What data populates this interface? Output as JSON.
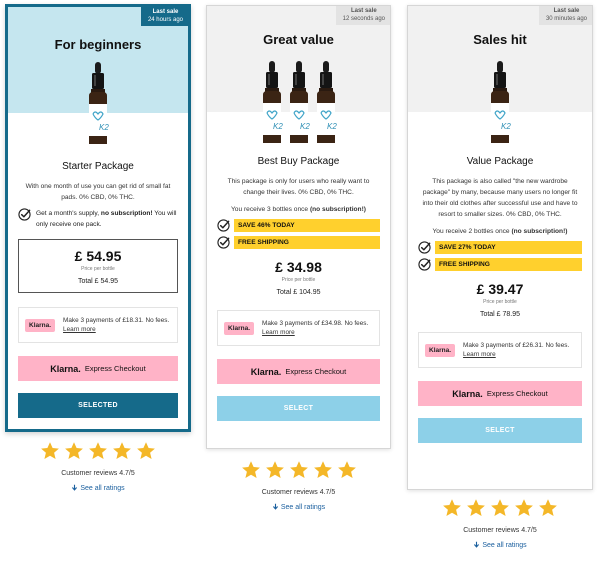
{
  "colors": {
    "selected_blue": "#156a8a",
    "light_blue": "#8dd0e8",
    "klarna_pink": "#ffb3c7",
    "promo_yellow": "#ffd02d",
    "star_gold": "#f4b728"
  },
  "cards": [
    {
      "last_sale_label": "Last sale",
      "last_sale_time": "24 hours ago",
      "heading": "For beginners",
      "package_name": "Starter Package",
      "description": "With one month of use you can get rid of small fat pads. 0% CBD, 0% THC.",
      "check_text_plain": "Get a month's supply, ",
      "check_text_bold": "no subscription!",
      "check_text_extra": " You will only receive one pack.",
      "price": "£ 54.95",
      "price_per_bottle": "Price per bottle",
      "total": "Total £ 54.95",
      "klarna_badge": "Klarna.",
      "klarna_text": "Make 3 payments of £18.31. No fees. ",
      "klarna_learn": "Learn more",
      "express_logo": "Klarna.",
      "express_label": "Express Checkout",
      "select_label": "SELECTED",
      "reviews_text": "Customer reviews 4.7/5",
      "see_all": "See all ratings"
    },
    {
      "last_sale_label": "Last sale",
      "last_sale_time": "12 seconds ago",
      "heading": "Great value",
      "package_name": "Best Buy Package",
      "description": "This package is only for users who really want to change their lives. 0% CBD, 0% THC.",
      "receive_plain": "You receive 3 bottles once ",
      "receive_bold": "(no subscription!)",
      "promo1": "SAVE 46% TODAY",
      "promo2": "FREE SHIPPING",
      "price": "£ 34.98",
      "price_per_bottle": "Price per bottle",
      "total": "Total £ 104.95",
      "klarna_badge": "Klarna.",
      "klarna_text": "Make 3 payments of £34.98. No fees. ",
      "klarna_learn": "Learn more",
      "express_logo": "Klarna.",
      "express_label": "Express Checkout",
      "select_label": "SELECT",
      "reviews_text": "Customer reviews 4.7/5",
      "see_all": "See all ratings"
    },
    {
      "last_sale_label": "Last sale",
      "last_sale_time": "30 minutes ago",
      "heading": "Sales hit",
      "package_name": "Value Package",
      "description": "This package is also called \"the new wardrobe package\" by many, because many users no longer fit into their old clothes after successful use and have to resort to smaller sizes. 0% CBD, 0% THC.",
      "receive_plain": "You receive 2 bottles once ",
      "receive_bold": "(no subscription!)",
      "promo1": "SAVE 27% TODAY",
      "promo2": "FREE SHIPPING",
      "price": "£ 39.47",
      "price_per_bottle": "Price per bottle",
      "total": "Total £ 78.95",
      "klarna_badge": "Klarna.",
      "klarna_text": "Make 3 payments of £26.31. No fees. ",
      "klarna_learn": "Learn more",
      "express_logo": "Klarna.",
      "express_label": "Express Checkout",
      "select_label": "SELECT",
      "reviews_text": "Customer reviews 4.7/5",
      "see_all": "See all ratings"
    }
  ],
  "ratings": {
    "stars_filled": 5,
    "stars_total": 5
  }
}
